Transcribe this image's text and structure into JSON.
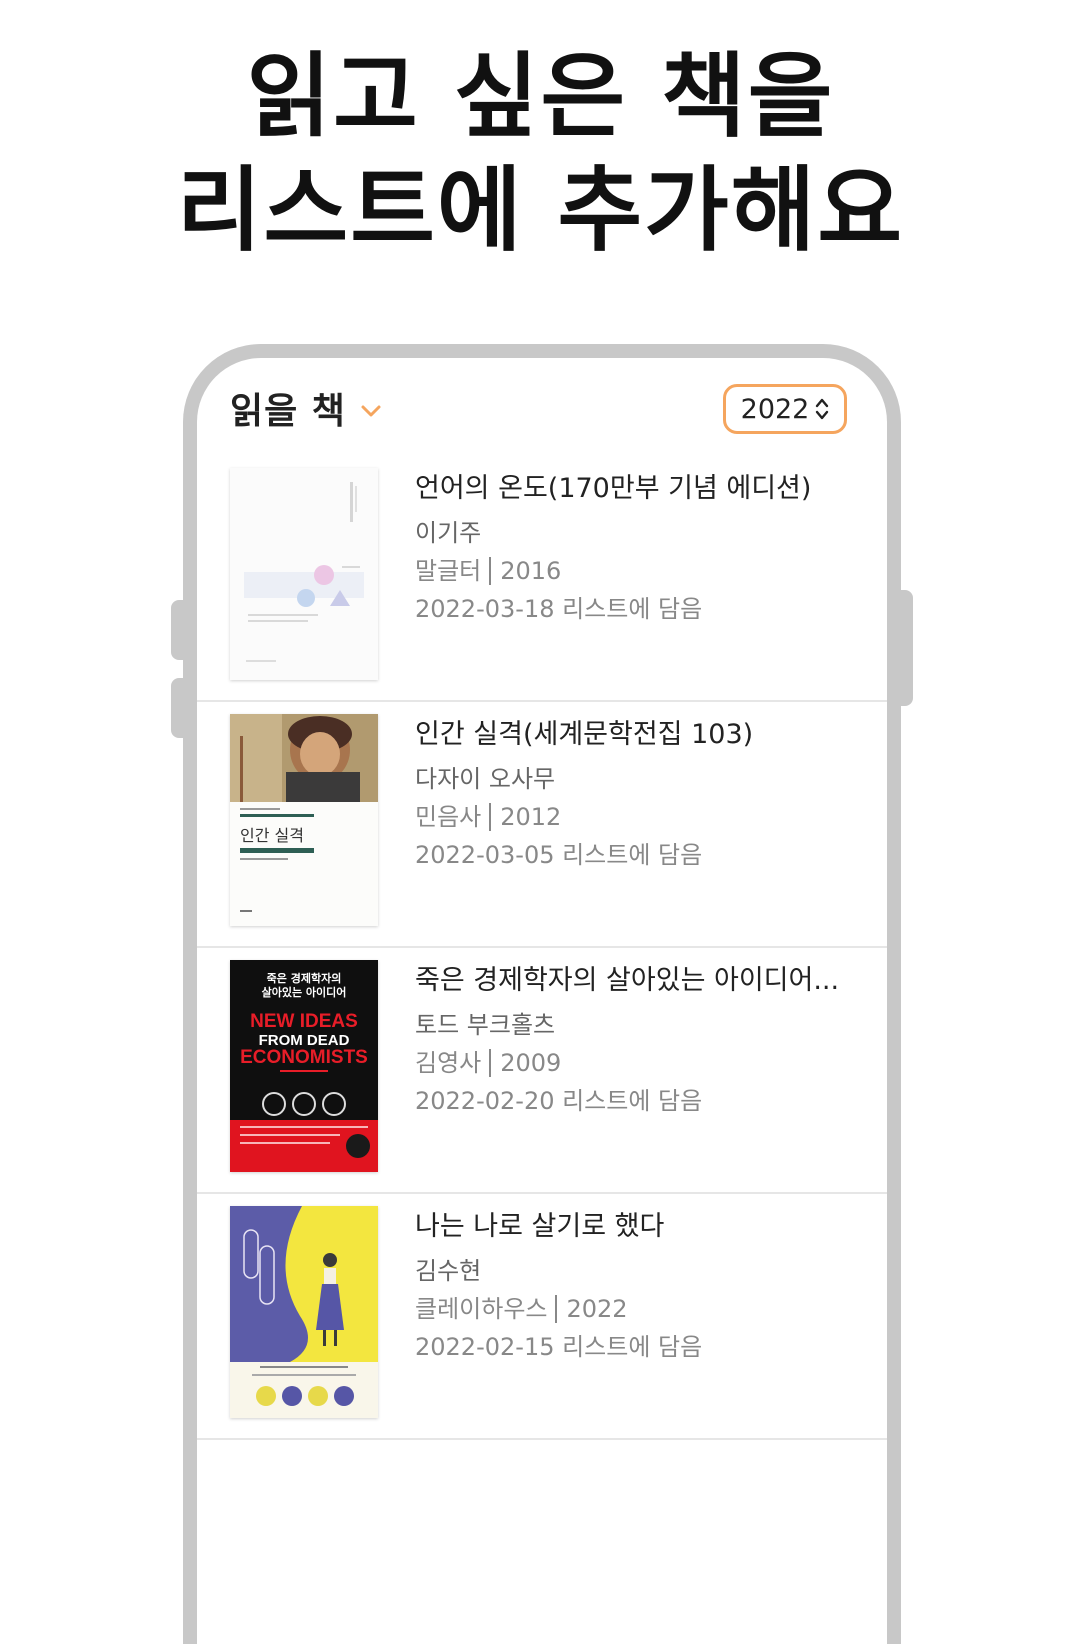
{
  "headline": {
    "line1": "읽고 싶은 책을",
    "line2": "리스트에 추가해요"
  },
  "list": {
    "title": "읽을 책",
    "year": "2022",
    "books": [
      {
        "title": "언어의 온도(170만부 기념 에디션)",
        "author": "이기주",
        "publisher": "말글터",
        "year": "2016",
        "added": "2022-03-18 리스트에 담음"
      },
      {
        "title": "인간 실격(세계문학전집 103)",
        "author": "다자이 오사무",
        "publisher": "민음사",
        "year": "2012",
        "added": "2022-03-05 리스트에 담음",
        "cover_title": "인간 실격"
      },
      {
        "title": "죽은 경제학자의 살아있는 아이디어...",
        "author": "토드 부크홀츠",
        "publisher": "김영사",
        "year": "2009",
        "added": "2022-02-20 리스트에 담음",
        "cover_kr": "죽은 경제학자의\n살아있는 아이디어",
        "cover_en1": "NEW IDEAS",
        "cover_en2": "FROM DEAD",
        "cover_en3": "ECONOMISTS"
      },
      {
        "title": "나는 나로 살기로 했다",
        "author": "김수현",
        "publisher": "클레이하우스",
        "year": "2022",
        "added": "2022-02-15 리스트에 담음"
      }
    ]
  },
  "colors": {
    "accent": "#f5a55e",
    "frame": "#c8c8c8",
    "divider": "#e6e6e6"
  }
}
